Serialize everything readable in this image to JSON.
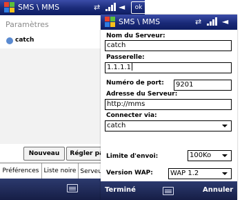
{
  "back_screen": {
    "title": "SMS \\ MMS",
    "ok_label": "ok",
    "page_heading": "Paramètres",
    "accounts": [
      {
        "name": "catch"
      }
    ],
    "buttons": {
      "new": "Nouveau",
      "configure": "Régler par"
    },
    "tabs": [
      {
        "label": "Préférences",
        "active": false
      },
      {
        "label": "Liste noire",
        "active": false
      },
      {
        "label": "Serveur",
        "active": true
      }
    ]
  },
  "front_screen": {
    "title": "SMS \\ MMS",
    "fields": {
      "server_name": {
        "label": "Nom du Serveur:",
        "value": "catch"
      },
      "gateway": {
        "label": "Passerelle:",
        "value": "1.1.1.1"
      },
      "port": {
        "label": "Numéro de port:",
        "value": "9201"
      },
      "server_address": {
        "label": "Adresse du Serveur:",
        "value": "http://mms"
      },
      "connect_via": {
        "label": "Connecter via:",
        "value": "catch"
      },
      "send_limit": {
        "label": "Limite d'envoi:",
        "value": "100Ko"
      },
      "wap_version": {
        "label": "Version WAP:",
        "value": "WAP 1.2"
      }
    },
    "softkeys": {
      "left": "Terminé",
      "right": "Annuler"
    }
  },
  "icons": [
    "windows-start-icon",
    "connectivity-icon",
    "signal-strength-icon",
    "volume-icon",
    "keyboard-icon",
    "account-icon"
  ]
}
